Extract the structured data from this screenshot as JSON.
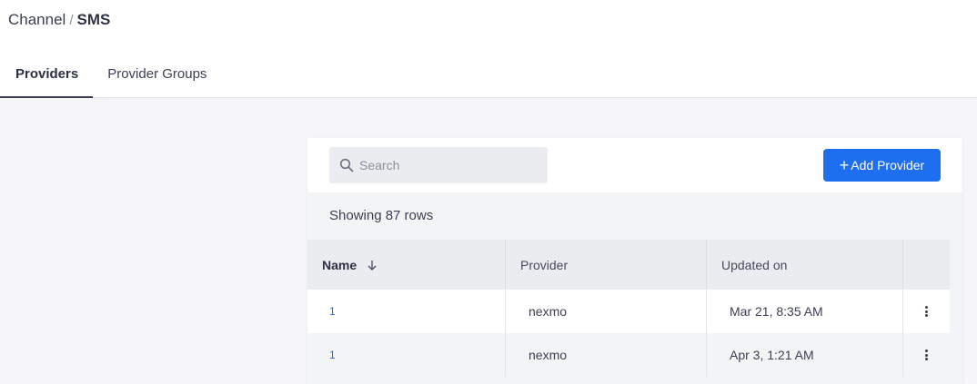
{
  "breadcrumb": {
    "parent": "Channel",
    "separator": "/",
    "current": "SMS"
  },
  "tabs": [
    {
      "label": "Providers",
      "active": true
    },
    {
      "label": "Provider Groups",
      "active": false
    }
  ],
  "search": {
    "placeholder": "Search",
    "value": ""
  },
  "add_button": {
    "label": "Add Provider"
  },
  "summary": {
    "showing": "Showing 87 rows"
  },
  "table": {
    "columns": [
      {
        "label": "Name",
        "sort": "descending"
      },
      {
        "label": "Provider"
      },
      {
        "label": "Updated on"
      }
    ],
    "rows": [
      {
        "name": "1",
        "provider": "nexmo",
        "updated": "Mar 21, 8:35 AM"
      },
      {
        "name": "1",
        "provider": "nexmo",
        "updated": "Apr 3, 1:21 AM"
      }
    ]
  },
  "colors": {
    "accent": "#1e6ff0",
    "header_bg": "#ebecf0"
  }
}
